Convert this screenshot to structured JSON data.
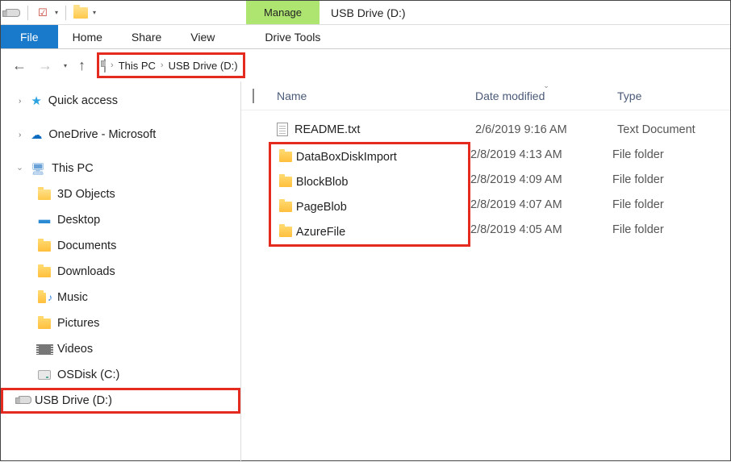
{
  "titlebar": {
    "context_tab": "Manage",
    "window_title": "USB Drive (D:)"
  },
  "ribbon": {
    "file": "File",
    "home": "Home",
    "share": "Share",
    "view": "View",
    "drive_tools": "Drive Tools"
  },
  "breadcrumb": {
    "root": "This PC",
    "current": "USB Drive (D:)"
  },
  "columns": {
    "name": "Name",
    "date": "Date modified",
    "type": "Type"
  },
  "sidebar": {
    "quick_access": "Quick access",
    "onedrive": "OneDrive - Microsoft",
    "this_pc": "This PC",
    "children": {
      "objects3d": "3D Objects",
      "desktop": "Desktop",
      "documents": "Documents",
      "downloads": "Downloads",
      "music": "Music",
      "pictures": "Pictures",
      "videos": "Videos",
      "osdisk": "OSDisk (C:)",
      "usb": "USB Drive (D:)"
    }
  },
  "files": [
    {
      "name": "README.txt",
      "date": "2/6/2019 9:16 AM",
      "type": "Text Document",
      "icon": "txt"
    },
    {
      "name": "DataBoxDiskImport",
      "date": "2/8/2019 4:13 AM",
      "type": "File folder",
      "icon": "folder"
    },
    {
      "name": "BlockBlob",
      "date": "2/8/2019 4:09 AM",
      "type": "File folder",
      "icon": "folder"
    },
    {
      "name": "PageBlob",
      "date": "2/8/2019 4:07 AM",
      "type": "File folder",
      "icon": "folder"
    },
    {
      "name": "AzureFile",
      "date": "2/8/2019 4:05 AM",
      "type": "File folder",
      "icon": "folder"
    }
  ]
}
